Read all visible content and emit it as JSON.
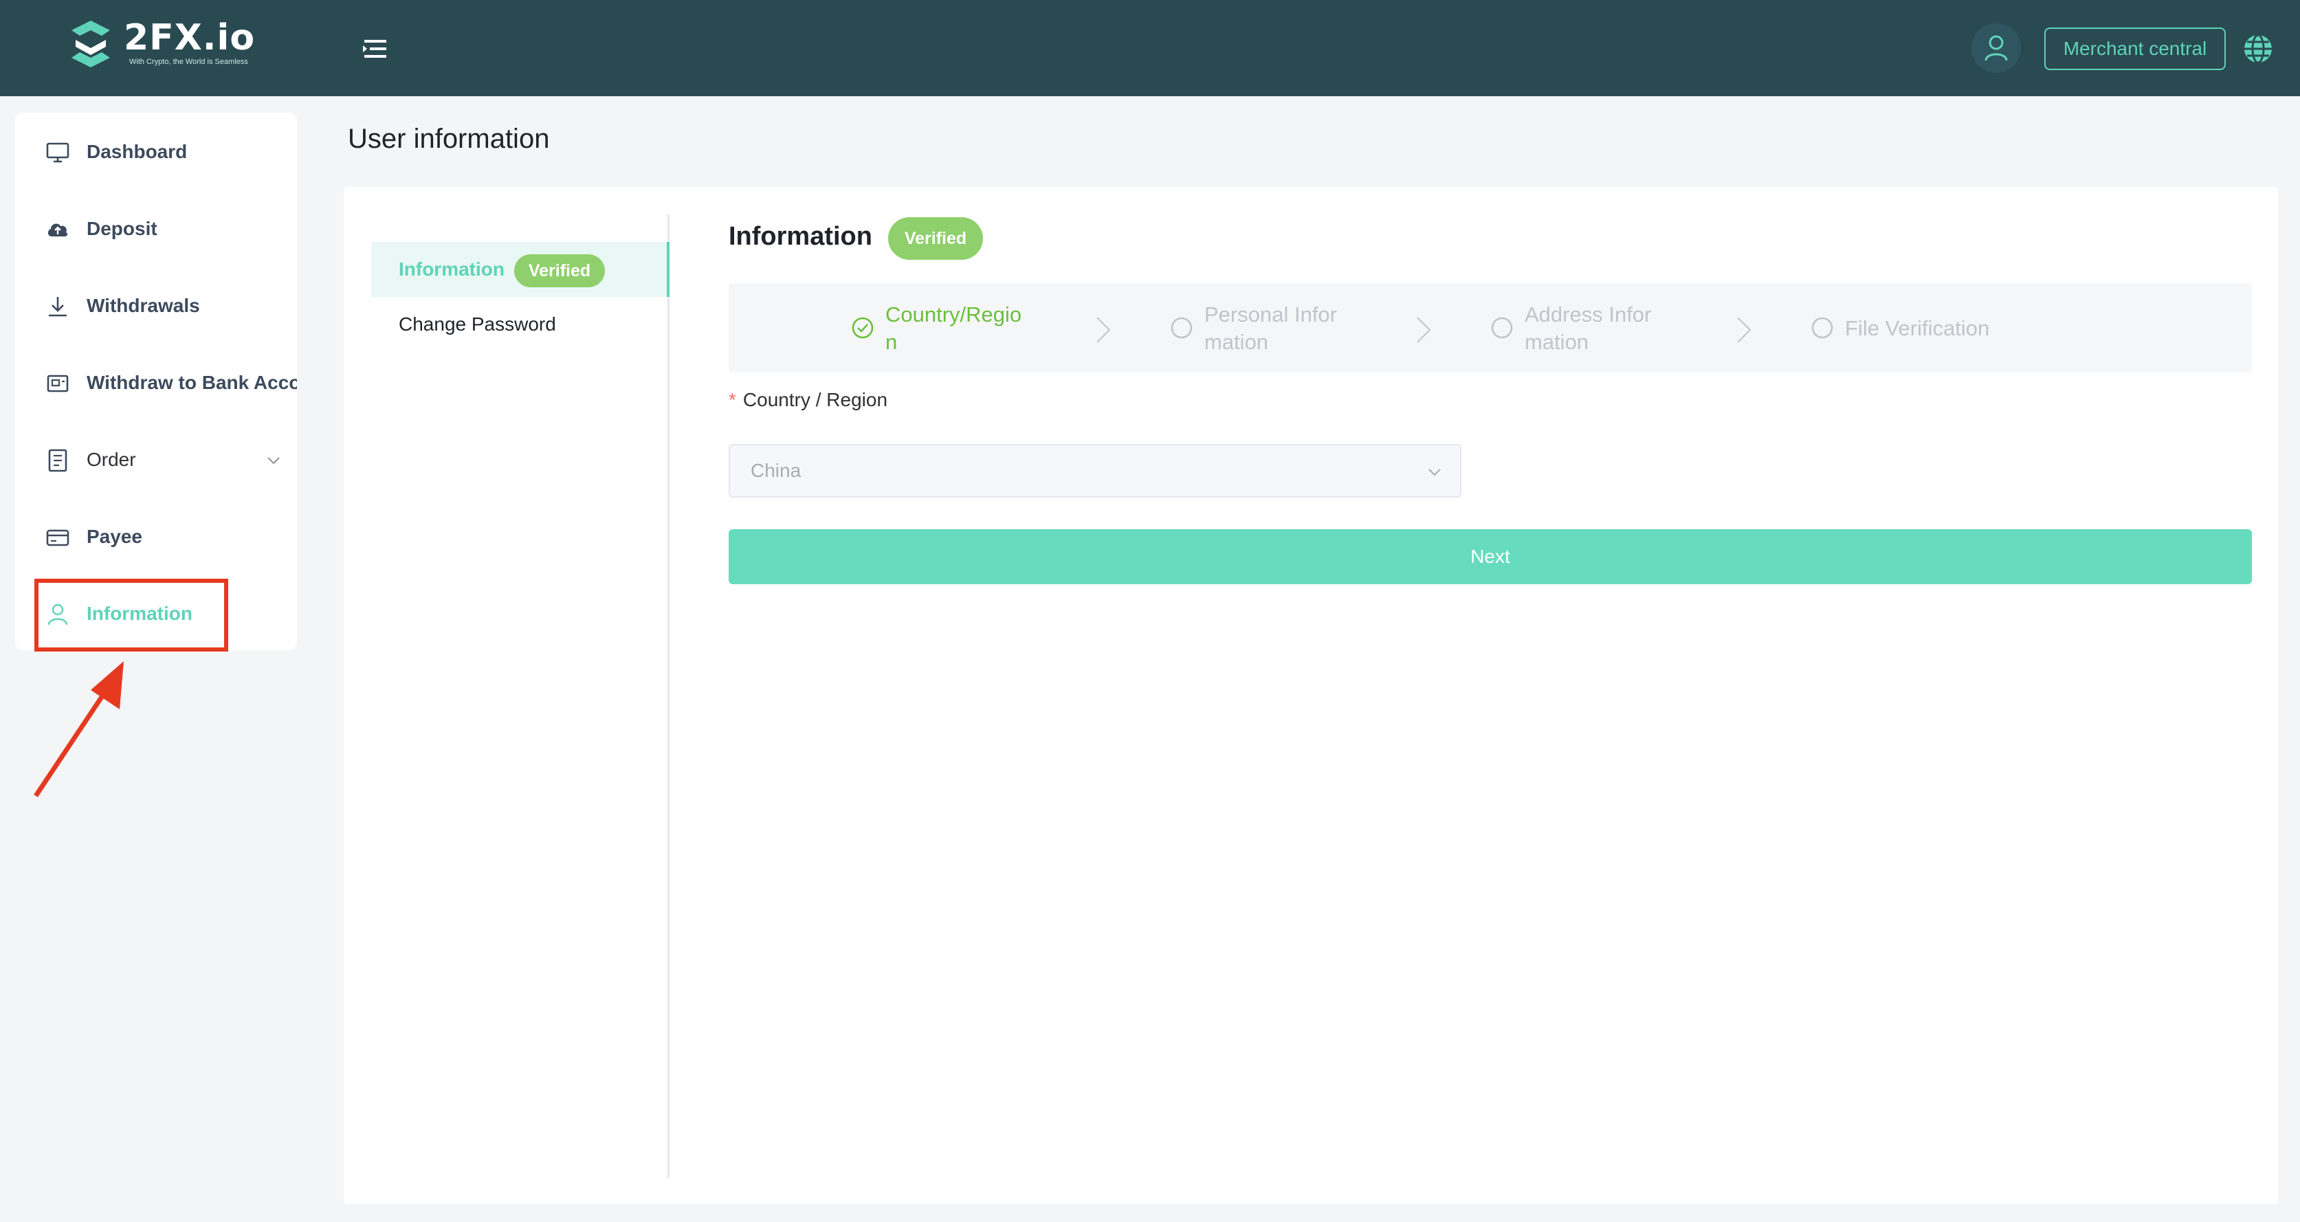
{
  "header": {
    "brand": "2FX.io",
    "tagline": "With Crypto, the World is Seamless",
    "merchant_button": "Merchant central",
    "brand_color": "#2a4a52",
    "accent_color": "#5fd3b8",
    "icons": [
      "logo-mark",
      "menu-toggle-icon",
      "user-icon",
      "globe-icon"
    ]
  },
  "sidebar": {
    "items": [
      {
        "label": "Dashboard",
        "icon": "monitor-icon",
        "active": false
      },
      {
        "label": "Deposit",
        "icon": "cloud-upload-icon",
        "active": false
      },
      {
        "label": "Withdrawals",
        "icon": "download-icon",
        "active": false
      },
      {
        "label": "Withdraw to Bank Acco",
        "icon": "bank-card-icon",
        "active": false
      },
      {
        "label": "Order",
        "icon": "document-list-icon",
        "active": false,
        "expandable": true
      },
      {
        "label": "Payee",
        "icon": "credit-card-icon",
        "active": false
      },
      {
        "label": "Information",
        "icon": "user-icon",
        "active": true
      }
    ]
  },
  "page": {
    "title": "User information"
  },
  "subnav": {
    "items": [
      {
        "label": "Information",
        "badge": "Verified",
        "active": true
      },
      {
        "label": "Change Password",
        "active": false
      }
    ]
  },
  "info": {
    "title": "Information",
    "badge": "Verified",
    "badge_color": "#8fcf6c"
  },
  "steps": [
    {
      "line1": "Country/Regio",
      "line2": "n",
      "status": "done"
    },
    {
      "line1": "Personal Infor",
      "line2": "mation",
      "status": "pending"
    },
    {
      "line1": "Address Infor",
      "line2": "mation",
      "status": "pending"
    },
    {
      "line1": "File Verification",
      "line2": "",
      "status": "pending"
    }
  ],
  "form": {
    "country_label": "Country / Region",
    "required_mark": "*",
    "country_value": "China",
    "next_button": "Next"
  },
  "annotation": {
    "highlight_color": "#e53a1f"
  }
}
